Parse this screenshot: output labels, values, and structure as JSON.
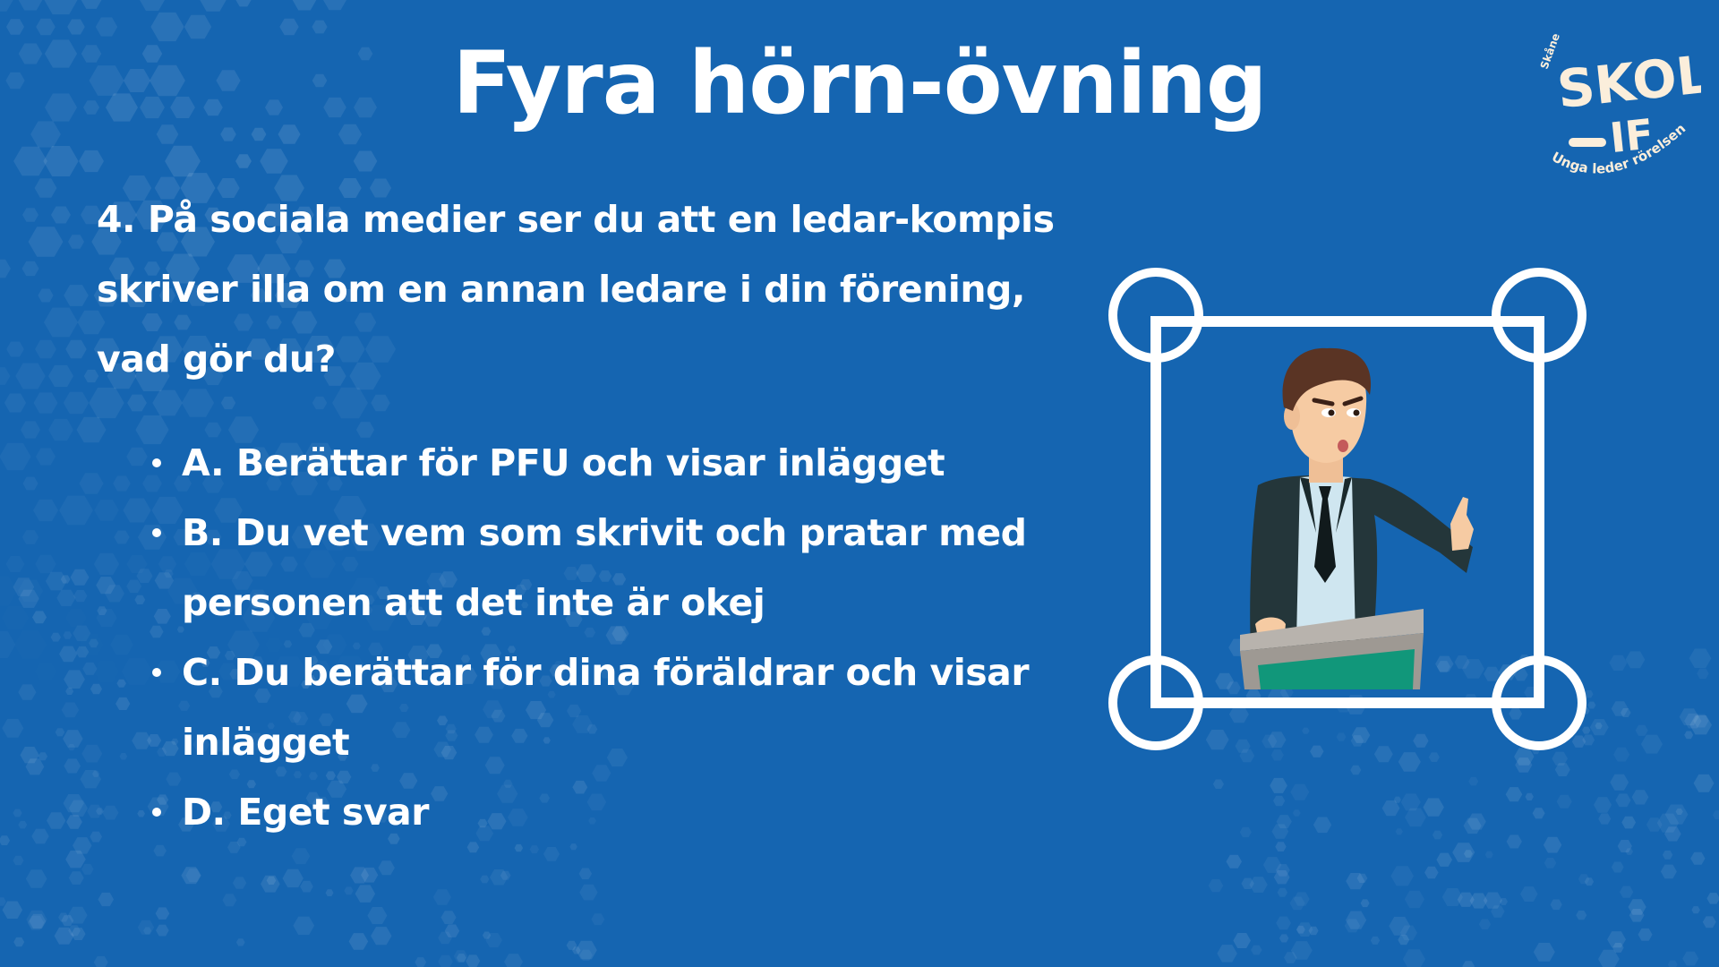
{
  "title": "Fyra hörn-övning",
  "logo": {
    "top_text": "Skåne",
    "brand_line1": "SKOL",
    "brand_line2": "IF",
    "tagline": "Unga leder rörelsen"
  },
  "question": "4. På sociala medier ser du att en ledar-kompis skriver illa om en annan ledare i din förening, vad gör du?",
  "answers": [
    "A. Berättar för PFU och visar inlägget",
    "B. Du vet vem som skrivit och pratar med personen att det inte är okej",
    "C. Du berättar för dina föräldrar och visar inlägget",
    "D. Eget svar"
  ],
  "colors": {
    "background": "#1565b1",
    "text": "#ffffff",
    "logo": "#fbeedb",
    "podium_front": "#11977a",
    "podium_top": "#b8b3ad",
    "suit": "#24363a"
  },
  "illustration": {
    "icon": "man-at-podium-icon",
    "frame_icon": "four-corners-frame-icon"
  }
}
